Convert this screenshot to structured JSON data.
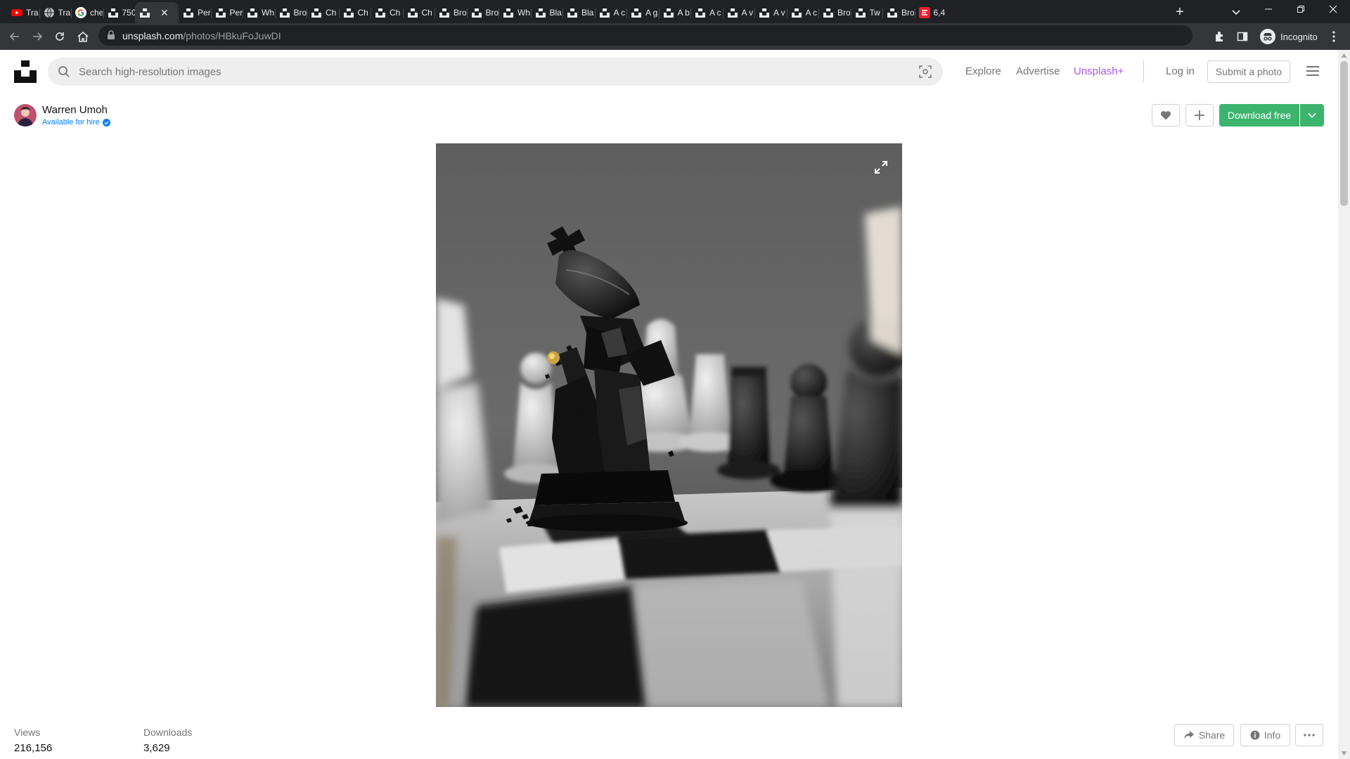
{
  "browser": {
    "tabs": [
      {
        "title": "Tra",
        "icon": "youtube-icon"
      },
      {
        "title": "Tra",
        "icon": "globe-icon"
      },
      {
        "title": "che",
        "icon": "google-icon"
      },
      {
        "title": "750",
        "icon": "unsplash-icon"
      },
      {
        "title": "",
        "icon": "unsplash-icon",
        "active": true
      },
      {
        "title": "Per",
        "icon": "unsplash-icon"
      },
      {
        "title": "Per",
        "icon": "unsplash-icon"
      },
      {
        "title": "Wh",
        "icon": "unsplash-icon"
      },
      {
        "title": "Bro",
        "icon": "unsplash-icon"
      },
      {
        "title": "Ch",
        "icon": "unsplash-icon"
      },
      {
        "title": "Ch",
        "icon": "unsplash-icon"
      },
      {
        "title": "Ch",
        "icon": "unsplash-icon"
      },
      {
        "title": "Ch",
        "icon": "unsplash-icon"
      },
      {
        "title": "Bro",
        "icon": "unsplash-icon"
      },
      {
        "title": "Bro",
        "icon": "unsplash-icon"
      },
      {
        "title": "Wh",
        "icon": "unsplash-icon"
      },
      {
        "title": "Bla",
        "icon": "unsplash-icon"
      },
      {
        "title": "Bla",
        "icon": "unsplash-icon"
      },
      {
        "title": "A c",
        "icon": "unsplash-icon"
      },
      {
        "title": "A g",
        "icon": "unsplash-icon"
      },
      {
        "title": "A b",
        "icon": "unsplash-icon"
      },
      {
        "title": "A c",
        "icon": "unsplash-icon"
      },
      {
        "title": "A v",
        "icon": "unsplash-icon"
      },
      {
        "title": "A v",
        "icon": "unsplash-icon"
      },
      {
        "title": "A c",
        "icon": "unsplash-icon"
      },
      {
        "title": "Bro",
        "icon": "unsplash-icon"
      },
      {
        "title": "Tw",
        "icon": "unsplash-icon"
      },
      {
        "title": "Bro",
        "icon": "unsplash-icon"
      },
      {
        "title": "6,4",
        "icon": "red-app-icon"
      }
    ],
    "url_host": "unsplash.com",
    "url_path": "/photos/HBkuFoJuwDI",
    "profile_label": "Incognito"
  },
  "header": {
    "search_placeholder": "Search high-resolution images",
    "nav": {
      "explore": "Explore",
      "advertise": "Advertise",
      "unsplash_plus": "Unsplash+"
    },
    "login": "Log in",
    "submit_photo": "Submit a photo"
  },
  "photo_header": {
    "author_name": "Warren Umoh",
    "hire_status": "Available for hire",
    "download_label": "Download free"
  },
  "stats": {
    "views_label": "Views",
    "views_value": "216,156",
    "downloads_label": "Downloads",
    "downloads_value": "3,629"
  },
  "actions": {
    "share": "Share",
    "info": "Info"
  },
  "colors": {
    "accent_green": "#3cb46e",
    "plus_purple": "#a855f7",
    "hire_blue": "#007fff"
  }
}
